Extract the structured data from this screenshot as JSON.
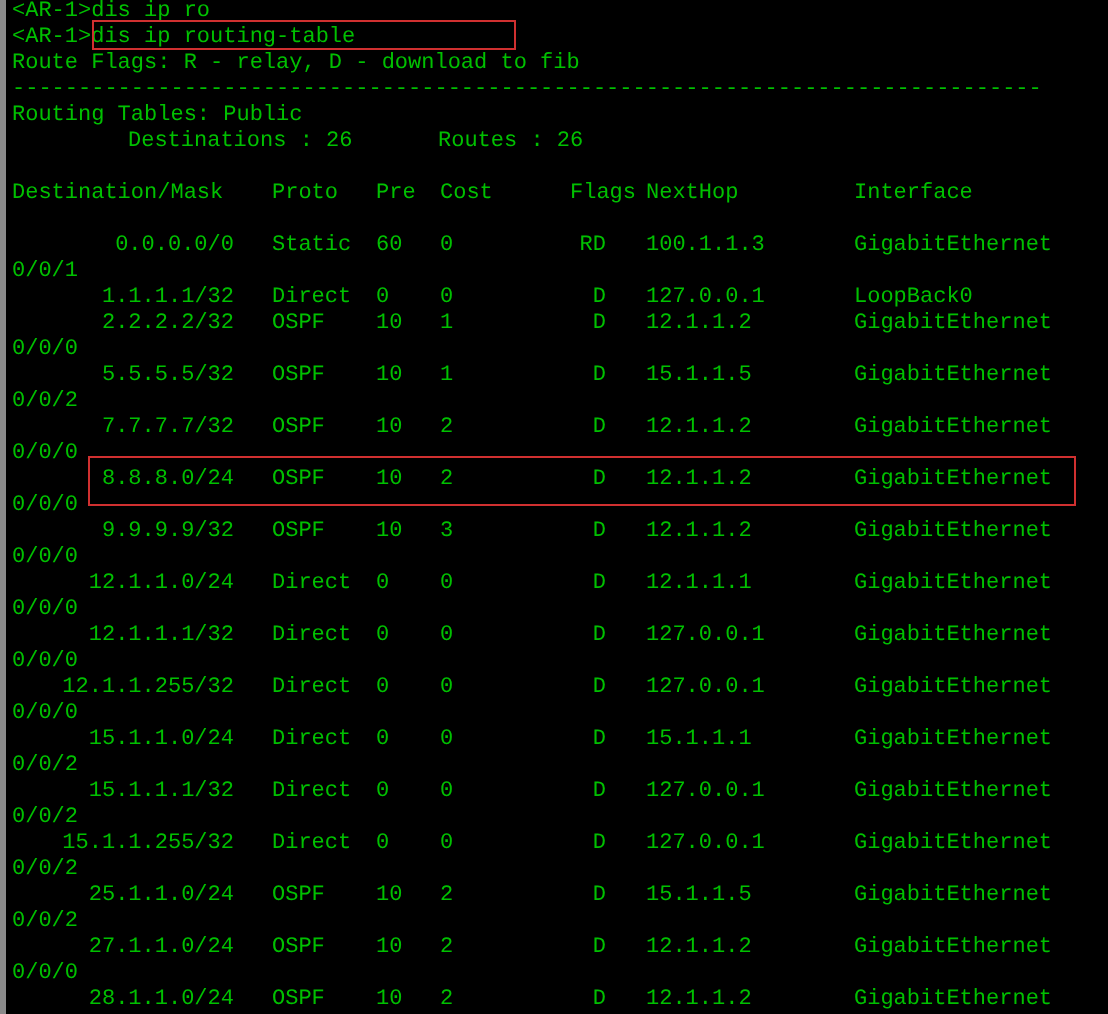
{
  "commands": [
    {
      "prompt": "<AR-1>",
      "text": "dis ip ro",
      "highlighted": false
    },
    {
      "prompt": "<AR-1>",
      "text": "dis ip routing-table",
      "highlighted": true
    }
  ],
  "flags_legend": "Route Flags: R - relay, D - download to fib",
  "separator": "------------------------------------------------------------------------------",
  "table_title": "Routing Tables: Public",
  "destinations": "Destinations : 26",
  "routes": "Routes : 26",
  "columns": [
    "Destination/Mask",
    "Proto",
    "Pre",
    "Cost",
    "Flags",
    "NextHop",
    "Interface"
  ],
  "rows": [
    {
      "destination": "0.0.0.0/0",
      "proto": "Static",
      "pre": "60",
      "cost": "0",
      "flags": "RD",
      "nexthop": "100.1.1.3",
      "interface": "GigabitEthernet",
      "port": "0/0/1",
      "highlighted": false
    },
    {
      "destination": "1.1.1.1/32",
      "proto": "Direct",
      "pre": "0",
      "cost": "0",
      "flags": "D",
      "nexthop": "127.0.0.1",
      "interface": "LoopBack0",
      "highlighted": false
    },
    {
      "destination": "2.2.2.2/32",
      "proto": "OSPF",
      "pre": "10",
      "cost": "1",
      "flags": "D",
      "nexthop": "12.1.1.2",
      "interface": "GigabitEthernet",
      "port": "0/0/0",
      "highlighted": false
    },
    {
      "destination": "5.5.5.5/32",
      "proto": "OSPF",
      "pre": "10",
      "cost": "1",
      "flags": "D",
      "nexthop": "15.1.1.5",
      "interface": "GigabitEthernet",
      "port": "0/0/2",
      "highlighted": false
    },
    {
      "destination": "7.7.7.7/32",
      "proto": "OSPF",
      "pre": "10",
      "cost": "2",
      "flags": "D",
      "nexthop": "12.1.1.2",
      "interface": "GigabitEthernet",
      "port": "0/0/0",
      "highlighted": false
    },
    {
      "destination": "8.8.8.0/24",
      "proto": "OSPF",
      "pre": "10",
      "cost": "2",
      "flags": "D",
      "nexthop": "12.1.1.2",
      "interface": "GigabitEthernet",
      "port": "0/0/0",
      "highlighted": true
    },
    {
      "destination": "9.9.9.9/32",
      "proto": "OSPF",
      "pre": "10",
      "cost": "3",
      "flags": "D",
      "nexthop": "12.1.1.2",
      "interface": "GigabitEthernet",
      "port": "0/0/0",
      "highlighted": false
    },
    {
      "destination": "12.1.1.0/24",
      "proto": "Direct",
      "pre": "0",
      "cost": "0",
      "flags": "D",
      "nexthop": "12.1.1.1",
      "interface": "GigabitEthernet",
      "port": "0/0/0",
      "highlighted": false
    },
    {
      "destination": "12.1.1.1/32",
      "proto": "Direct",
      "pre": "0",
      "cost": "0",
      "flags": "D",
      "nexthop": "127.0.0.1",
      "interface": "GigabitEthernet",
      "port": "0/0/0",
      "highlighted": false
    },
    {
      "destination": "12.1.1.255/32",
      "proto": "Direct",
      "pre": "0",
      "cost": "0",
      "flags": "D",
      "nexthop": "127.0.0.1",
      "interface": "GigabitEthernet",
      "port": "0/0/0",
      "highlighted": false
    },
    {
      "destination": "15.1.1.0/24",
      "proto": "Direct",
      "pre": "0",
      "cost": "0",
      "flags": "D",
      "nexthop": "15.1.1.1",
      "interface": "GigabitEthernet",
      "port": "0/0/2",
      "highlighted": false
    },
    {
      "destination": "15.1.1.1/32",
      "proto": "Direct",
      "pre": "0",
      "cost": "0",
      "flags": "D",
      "nexthop": "127.0.0.1",
      "interface": "GigabitEthernet",
      "port": "0/0/2",
      "highlighted": false
    },
    {
      "destination": "15.1.1.255/32",
      "proto": "Direct",
      "pre": "0",
      "cost": "0",
      "flags": "D",
      "nexthop": "127.0.0.1",
      "interface": "GigabitEthernet",
      "port": "0/0/2",
      "highlighted": false
    },
    {
      "destination": "25.1.1.0/24",
      "proto": "OSPF",
      "pre": "10",
      "cost": "2",
      "flags": "D",
      "nexthop": "15.1.1.5",
      "interface": "GigabitEthernet",
      "port": "0/0/2",
      "highlighted": false
    },
    {
      "destination": "27.1.1.0/24",
      "proto": "OSPF",
      "pre": "10",
      "cost": "2",
      "flags": "D",
      "nexthop": "12.1.1.2",
      "interface": "GigabitEthernet",
      "port": "0/0/0",
      "highlighted": false
    },
    {
      "destination": "28.1.1.0/24",
      "proto": "OSPF",
      "pre": "10",
      "cost": "2",
      "flags": "D",
      "nexthop": "12.1.1.2",
      "interface": "GigabitEthernet",
      "highlighted": false
    }
  ]
}
